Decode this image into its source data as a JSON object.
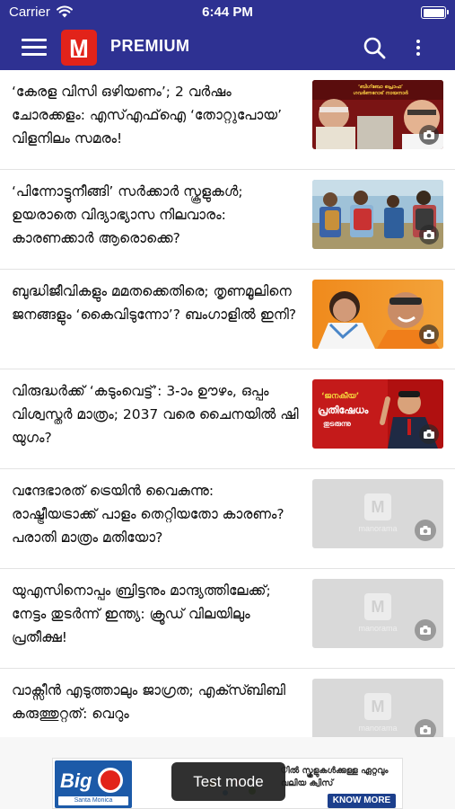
{
  "status_bar": {
    "carrier": "Carrier",
    "time": "6:44 PM"
  },
  "header": {
    "logo_letter": "M",
    "title": "PREMIUM",
    "brand_color": "#2e3192",
    "logo_color": "#e2231a"
  },
  "articles": [
    {
      "title": "‘കേരള വിസി ഒഴിയണം’; 2 വർഷം ചോരക്കളം: എസ്എഫ്ഐ ‘തോറ്റുപോയ’ വിളനിലം സമരം!",
      "thumb_caption": "‘ബിഗ്‌ബോ പ്രൊഫ’ ഗവർണറോട് നായനാർ"
    },
    {
      "title": "‘പിന്നോട്ടുനീങ്ങി’ സർക്കാർ സ്കൂളുകൾ; ഉയരാതെ വിദ്യാഭ്യാസ നിലവാരം: കാരണക്കാർ ആരൊക്കെ?"
    },
    {
      "title": "ബുദ്ധിജീവികളും മമതക്കെതിരെ; തൃണമൂലിനെ ജനങ്ങളും ‘കൈവിടുന്നോ’? ബംഗാളിൽ ഇനി?"
    },
    {
      "title": "വിരുദ്ധർക്ക് ‘കടുംവെട്ട്’: 3-ാം ഊഴം, ഒപ്പം വിശ്വസ്തർ മാത്രം; 2037 വരെ ചൈനയിൽ ഷി യുഗം?",
      "thumb_caption_1": "‘ജനകീയ’",
      "thumb_caption_2": "പ്രതിഷേധം",
      "thumb_caption_3": "തുടരുന്നു"
    },
    {
      "title": "വന്ദേഭാരത് ട്രെയിൻ വൈകുന്നു: രാഷ്ട്രീയട്രാക്ക് പാളം തെറ്റിയതോ കാരണം? പരാതി മാത്രം മതിയോ?"
    },
    {
      "title": "യുഎസിനൊപ്പം ബ്രിട്ടനും മാന്ദ്യത്തിലേക്ക്; നേട്ടം തുടർന്ന് ഇന്ത്യ: ക്രൂഡ് വിലയിലും പ്രതീക്ഷ!"
    },
    {
      "title": "വാക്സീൻ എടുത്താലും ജാഗ്രത; എക്സ്ബിബി കരുത്തുറ്റത്: വെറും"
    }
  ],
  "placeholder": {
    "logo_letter": "M",
    "brand": "manorama"
  },
  "ad": {
    "brand_big": "Big",
    "brand_sub": "Santa Monica",
    "headline": "ിൽ സ്കൂളുകൾക്കുള്ള ഏറ്റവും വലിയ ക്വിസ്",
    "cta": "KNOW MORE"
  },
  "toast": "Test mode"
}
